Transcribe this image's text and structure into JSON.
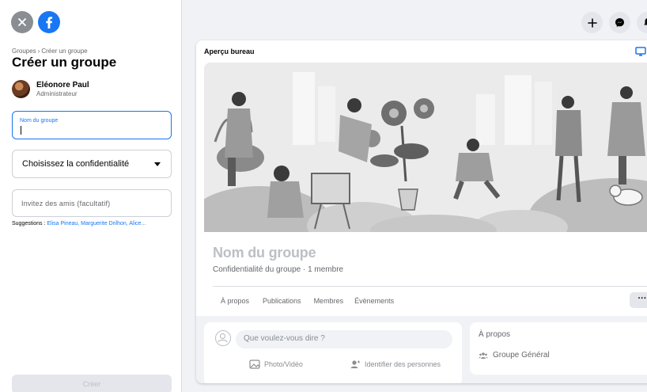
{
  "breadcrumb": {
    "parent": "Groupes",
    "separator": "›",
    "current": "Créer un groupe"
  },
  "page_title": "Créer un groupe",
  "user": {
    "name": "Eléonore Paul",
    "role": "Administrateur"
  },
  "form": {
    "group_name_label": "Nom du groupe",
    "privacy_placeholder": "Choisissez la confidentialité",
    "invite_placeholder": "Invitez des amis (facultatif)",
    "suggestions_prefix": "Suggestions : ",
    "suggestions_names": "Elisa Pineau, Marguerite Drilhon, Alice..."
  },
  "create_button": "Créer",
  "top_icons": [
    "plus-icon",
    "messenger-icon",
    "bell-icon"
  ],
  "preview": {
    "header": "Aperçu bureau",
    "group_name": "Nom du groupe",
    "meta": "Confidentialité du groupe · 1 membre",
    "tabs": [
      "À propos",
      "Publications",
      "Membres",
      "Évènements"
    ],
    "more": "···",
    "composer_placeholder": "Que voulez-vous dire ?",
    "photo_video": "Photo/Vidéo",
    "tag_people": "Identifier des personnes",
    "about_title": "À propos",
    "about_item": "Groupe Général"
  },
  "colors": {
    "brand": "#1877f2",
    "muted": "#65676b",
    "disabled": "#bcc0c4"
  }
}
